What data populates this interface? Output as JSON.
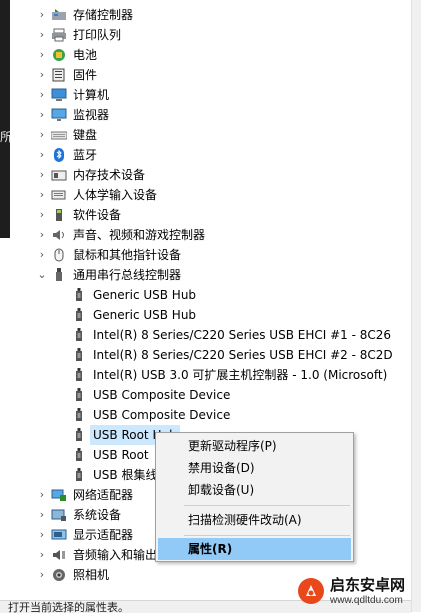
{
  "left_edge_text": "所",
  "tree": {
    "categories_top": [
      {
        "label": "存储控制器",
        "icon": "storage-controller-icon"
      },
      {
        "label": "打印队列",
        "icon": "printer-icon"
      },
      {
        "label": "电池",
        "icon": "battery-icon"
      },
      {
        "label": "固件",
        "icon": "firmware-icon"
      },
      {
        "label": "计算机",
        "icon": "computer-icon"
      },
      {
        "label": "监视器",
        "icon": "monitor-icon"
      },
      {
        "label": "键盘",
        "icon": "keyboard-icon"
      },
      {
        "label": "蓝牙",
        "icon": "bluetooth-icon"
      },
      {
        "label": "内存技术设备",
        "icon": "memory-device-icon"
      },
      {
        "label": "人体学输入设备",
        "icon": "hid-icon"
      },
      {
        "label": "软件设备",
        "icon": "software-device-icon"
      },
      {
        "label": "声音、视频和游戏控制器",
        "icon": "sound-icon"
      },
      {
        "label": "鼠标和其他指针设备",
        "icon": "mouse-icon"
      }
    ],
    "usb_category": {
      "label": "通用串行总线控制器",
      "icon": "usb-controller-icon"
    },
    "usb_children": [
      {
        "label": "Generic USB Hub",
        "selected": false
      },
      {
        "label": "Generic USB Hub",
        "selected": false
      },
      {
        "label": "Intel(R) 8 Series/C220 Series  USB EHCI #1 - 8C26",
        "selected": false
      },
      {
        "label": "Intel(R) 8 Series/C220 Series  USB EHCI #2 - 8C2D",
        "selected": false
      },
      {
        "label": "Intel(R) USB 3.0 可扩展主机控制器 - 1.0 (Microsoft)",
        "selected": false
      },
      {
        "label": "USB Composite Device",
        "selected": false
      },
      {
        "label": "USB Composite Device",
        "selected": false
      },
      {
        "label": "USB Root Hub",
        "selected": true
      },
      {
        "label": "USB Root",
        "selected": false
      },
      {
        "label": "USB 根集线器",
        "selected": false
      }
    ],
    "categories_bottom": [
      {
        "label": "网络适配器",
        "icon": "network-adapter-icon"
      },
      {
        "label": "系统设备",
        "icon": "system-device-icon"
      },
      {
        "label": "显示适配器",
        "icon": "display-adapter-icon"
      },
      {
        "label": "音频输入和输出",
        "icon": "audio-io-icon"
      },
      {
        "label": "照相机",
        "icon": "camera-icon"
      }
    ]
  },
  "context_menu": {
    "items": [
      {
        "label": "更新驱动程序(P)",
        "active": false
      },
      {
        "label": "禁用设备(D)",
        "active": false
      },
      {
        "label": "卸载设备(U)",
        "active": false
      },
      {
        "label": "扫描检测硬件改动(A)",
        "active": false
      },
      {
        "label": "属性(R)",
        "active": true
      }
    ]
  },
  "status_bar": {
    "text": "打开当前选择的属性表。"
  },
  "watermark": {
    "title": "启东安卓网",
    "url": "www.qdltdu.com",
    "brand_color": "#e8481a"
  }
}
